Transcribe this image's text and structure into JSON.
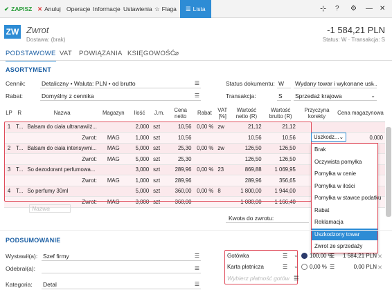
{
  "toolbar": {
    "save": "ZAPISZ",
    "cancel": "Anuluj",
    "operations": "Operacje",
    "info": "Informacje",
    "settings": "Ustawienia",
    "flag": "Flaga",
    "list": "Lista"
  },
  "header": {
    "badge": "ZW",
    "title": "Zwrot",
    "subtitle": "Dostawa: (brak)",
    "amount": "-1 584,21 PLN",
    "status": "Status: W · Transakcja: S"
  },
  "tabs": [
    "PODSTAWOWE",
    "VAT",
    "POWIĄZANIA",
    "KSIĘGOWOŚĆ"
  ],
  "assortment": {
    "title": "ASORTYMENT",
    "price_list_label": "Cennik:",
    "price_list_value": "Detaliczny • Waluta: PLN • od brutto",
    "discount_label": "Rabat:",
    "discount_value": "Domyślny z cennika",
    "doc_status_label": "Status dokumentu:",
    "doc_status_code": "W",
    "doc_status_value": "Wydany towar i wykonane usł...",
    "transaction_label": "Transakcja:",
    "transaction_code": "S",
    "transaction_value": "Sprzedaż krajowa"
  },
  "table": {
    "headers": [
      "LP",
      "R",
      "Nazwa",
      "Magazyn",
      "Ilość",
      "J.m.",
      "Cena netto",
      "Rabat",
      "VAT [%]",
      "Wartość netto (R)",
      "Wartość brutto (R)",
      "Przyczyna korekty",
      "Cena magazynowa"
    ],
    "rows": [
      {
        "lp": "1",
        "r": "T...",
        "name": "Balsam do ciała ultranawilż...",
        "mag": "",
        "qty": "2,000",
        "jm": "szt",
        "price": "10,56",
        "disc": "0,00 %",
        "vat": "zw",
        "net": "21,12",
        "gross": "21,12",
        "reason": "",
        "whprice": "",
        "kind": "pink"
      },
      {
        "lp": "",
        "r": "",
        "name": "Zwrot:",
        "mag": "MAG",
        "qty": "1,000",
        "jm": "szt",
        "price": "10,56",
        "disc": "",
        "vat": "",
        "net": "10,56",
        "gross": "10,56",
        "reason": "Uszkodz...",
        "whprice": "0,000",
        "kind": "pinklight"
      },
      {
        "lp": "2",
        "r": "T...",
        "name": "Balsam do ciała intensywni...",
        "mag": "MAG",
        "qty": "5,000",
        "jm": "szt",
        "price": "25,30",
        "disc": "0,00 %",
        "vat": "zw",
        "net": "126,50",
        "gross": "126,50",
        "reason": "",
        "whprice": "",
        "kind": "pink"
      },
      {
        "lp": "",
        "r": "",
        "name": "Zwrot:",
        "mag": "MAG",
        "qty": "5,000",
        "jm": "szt",
        "price": "25,30",
        "disc": "",
        "vat": "",
        "net": "126,50",
        "gross": "126,50",
        "reason": "",
        "whprice": "",
        "kind": "pinklight"
      },
      {
        "lp": "3",
        "r": "T...",
        "name": "So dezodorant perfumowa...",
        "mag": "",
        "qty": "3,000",
        "jm": "szt",
        "price": "289,96",
        "disc": "0,00 %",
        "vat": "23",
        "net": "869,88",
        "gross": "1 069,95",
        "reason": "",
        "whprice": "",
        "kind": "pink"
      },
      {
        "lp": "",
        "r": "",
        "name": "Zwrot:",
        "mag": "MAG",
        "qty": "1,000",
        "jm": "szt",
        "price": "289,96",
        "disc": "",
        "vat": "",
        "net": "289,96",
        "gross": "356,65",
        "reason": "",
        "whprice": "",
        "kind": "pinklight"
      },
      {
        "lp": "4",
        "r": "T...",
        "name": "So perfumy 30ml",
        "mag": "",
        "qty": "5,000",
        "jm": "szt",
        "price": "360,00",
        "disc": "0,00 %",
        "vat": "8",
        "net": "1 800,00",
        "gross": "1 944,00",
        "reason": "",
        "whprice": "",
        "kind": "pink"
      },
      {
        "lp": "",
        "r": "",
        "name": "Zwrot:",
        "mag": "MAG",
        "qty": "3,000",
        "jm": "szt",
        "price": "360,00",
        "disc": "",
        "vat": "",
        "net": "1 080,00",
        "gross": "1 166,40",
        "reason": "",
        "whprice": "",
        "kind": "pinklight"
      }
    ],
    "name_placeholder": "Nazwa"
  },
  "reason_dropdown": {
    "selected": "Uszkodzony towar",
    "options": [
      "Brak",
      "Oczywista pomyłka",
      "Pomyłka w cenie",
      "Pomyłka w ilości",
      "Pomyłka w stawce podatku",
      "Rabat",
      "Reklamacja",
      "Uszkodzony towar",
      "Zwrot ze sprzedaży"
    ]
  },
  "refund_label": "Kwota do zwrotu:",
  "summary": {
    "title": "PODSUMOWANIE",
    "issued_label": "Wystawił(a):",
    "issued_value": "Szef firmy",
    "received_label": "Odebrał(a):",
    "category_label": "Kategoria:",
    "category_value": "Detal",
    "payments": [
      {
        "name": "Gotówka",
        "pct": "100,00 %",
        "amount": "1 584,21 PLN",
        "selected": true
      },
      {
        "name": "Karta płatnicza",
        "pct": "0,00 %",
        "amount": "0,00 PLN",
        "selected": false
      }
    ],
    "payment_placeholder": "Wybierz płatność gotów"
  },
  "colors": {
    "accent": "#2d8cd5",
    "error": "#e04b5a",
    "row_bg": "#fbe9ec"
  }
}
